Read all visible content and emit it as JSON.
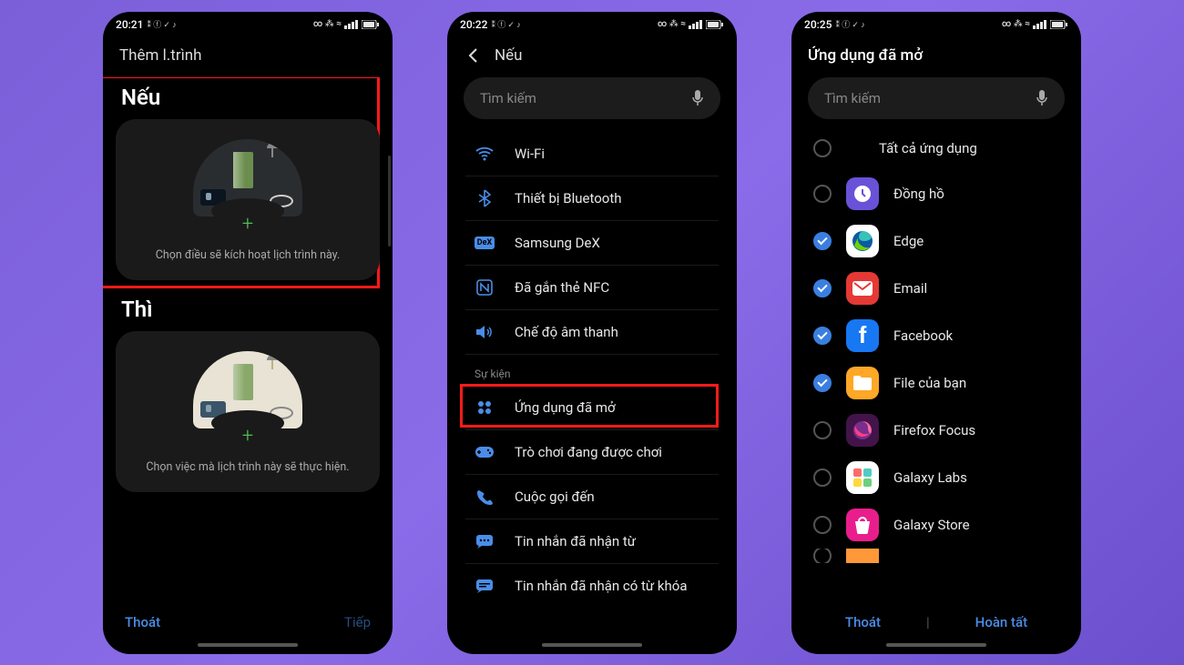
{
  "screen1": {
    "time": "20:21",
    "status_icons": "⚡ ⓕ ✓ ♪",
    "right_icons": "∞ ⁂ ≈ ⚹ ▮",
    "header": "Thêm l.trình",
    "if_title": "Nếu",
    "if_desc": "Chọn điều sẽ kích hoạt lịch trình này.",
    "then_title": "Thì",
    "then_desc": "Chọn việc mà lịch trình này sẽ thực hiện.",
    "btn_exit": "Thoát",
    "btn_next": "Tiếp"
  },
  "screen2": {
    "time": "20:22",
    "header": "Nếu",
    "search_placeholder": "Tìm kiếm",
    "section_event": "Sự kiện",
    "items": [
      {
        "icon": "wifi",
        "label": "Wi-Fi"
      },
      {
        "icon": "bluetooth",
        "label": "Thiết bị Bluetooth"
      },
      {
        "icon": "dex",
        "label": "Samsung DeX"
      },
      {
        "icon": "nfc",
        "label": "Đã gắn thẻ NFC"
      },
      {
        "icon": "sound",
        "label": "Chế độ âm thanh"
      }
    ],
    "events": [
      {
        "icon": "apps",
        "label": "Ứng dụng đã mở"
      },
      {
        "icon": "game",
        "label": "Trò chơi đang được chơi"
      },
      {
        "icon": "call",
        "label": "Cuộc gọi đến"
      },
      {
        "icon": "sms",
        "label": "Tin nhắn đã nhận từ"
      },
      {
        "icon": "sms2",
        "label": "Tin nhắn đã nhận có từ khóa"
      }
    ]
  },
  "screen3": {
    "time": "20:25",
    "header": "Ứng dụng đã mở",
    "search_placeholder": "Tìm kiếm",
    "all_apps": "Tất cả ứng dụng",
    "apps": [
      {
        "name": "Đồng hồ",
        "checked": false,
        "bg": "#6a52d8",
        "glyph": "◷"
      },
      {
        "name": "Edge",
        "checked": true,
        "bg": "#fff",
        "glyph": "e"
      },
      {
        "name": "Email",
        "checked": true,
        "bg": "#e53935",
        "glyph": "✉"
      },
      {
        "name": "Facebook",
        "checked": true,
        "bg": "#1877f2",
        "glyph": "f"
      },
      {
        "name": "File của bạn",
        "checked": true,
        "bg": "#ffa726",
        "glyph": "📁"
      },
      {
        "name": "Firefox Focus",
        "checked": false,
        "bg": "#42144a",
        "glyph": "🔥"
      },
      {
        "name": "Galaxy Labs",
        "checked": false,
        "bg": "#fff",
        "glyph": "◧"
      },
      {
        "name": "Galaxy Store",
        "checked": false,
        "bg": "#e91e8c",
        "glyph": "🛍"
      }
    ],
    "btn_exit": "Thoát",
    "btn_done": "Hoàn tất"
  }
}
